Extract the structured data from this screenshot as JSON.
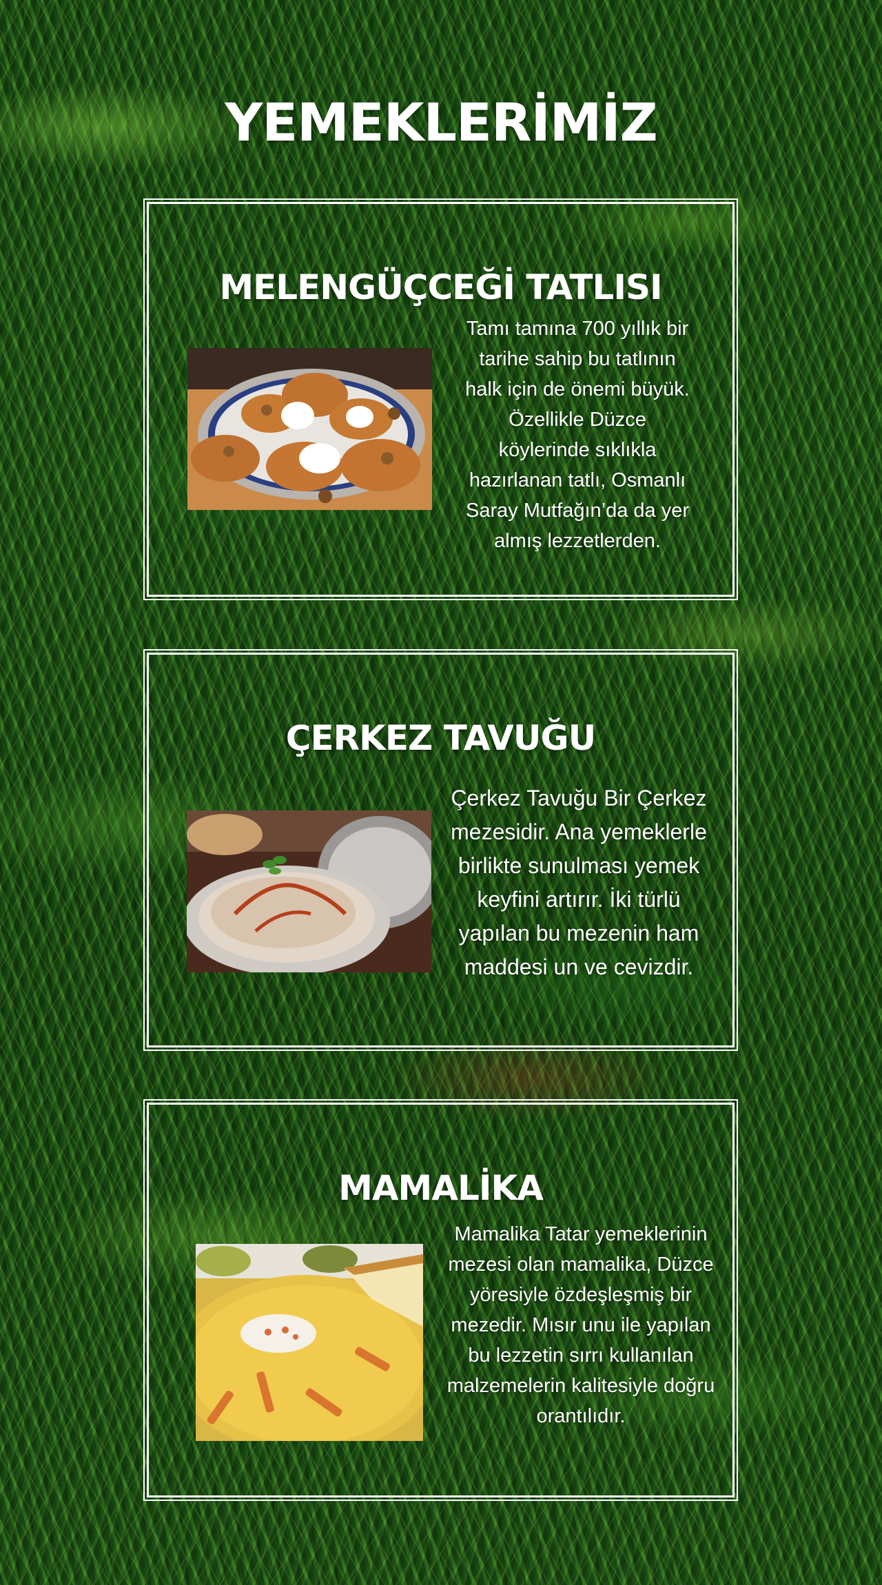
{
  "page": {
    "title": "YEMEKLERİMİZ"
  },
  "dishes": [
    {
      "title": "MELENGÜÇCEĞİ TATLISI",
      "description": "Tamı tamına 700 yıllık bir tarihe sahip bu tatlının halk için de önemi büyük. Özellikle Düzce köylerinde sıklıkla hazırlanan tatlı, Osmanlı Saray Mutfağın’da da yer almış lezzetlerden."
    },
    {
      "title": "ÇERKEZ TAVUĞU",
      "description": "Çerkez Tavuğu Bir Çerkez mezesidir. Ana yemeklerle birlikte sunulması yemek keyfini artırır. İki türlü yapılan bu mezenin ham maddesi un ve cevizdir."
    },
    {
      "title": "MAMALİKA",
      "description": "Mamalika Tatar yemeklerinin mezesi olan mamalika, Düzce yöresiyle özdeşleşmiş bir mezedir. Mısır unu ile yapılan bu lezzetin sırrı kullanılan malzemelerin kalitesiyle doğru orantılıdır."
    }
  ],
  "colors": {
    "text": "#ffffff",
    "frame": "#ffffff",
    "grass_dark": "#1a4214",
    "grass_light": "#6fae3a"
  }
}
